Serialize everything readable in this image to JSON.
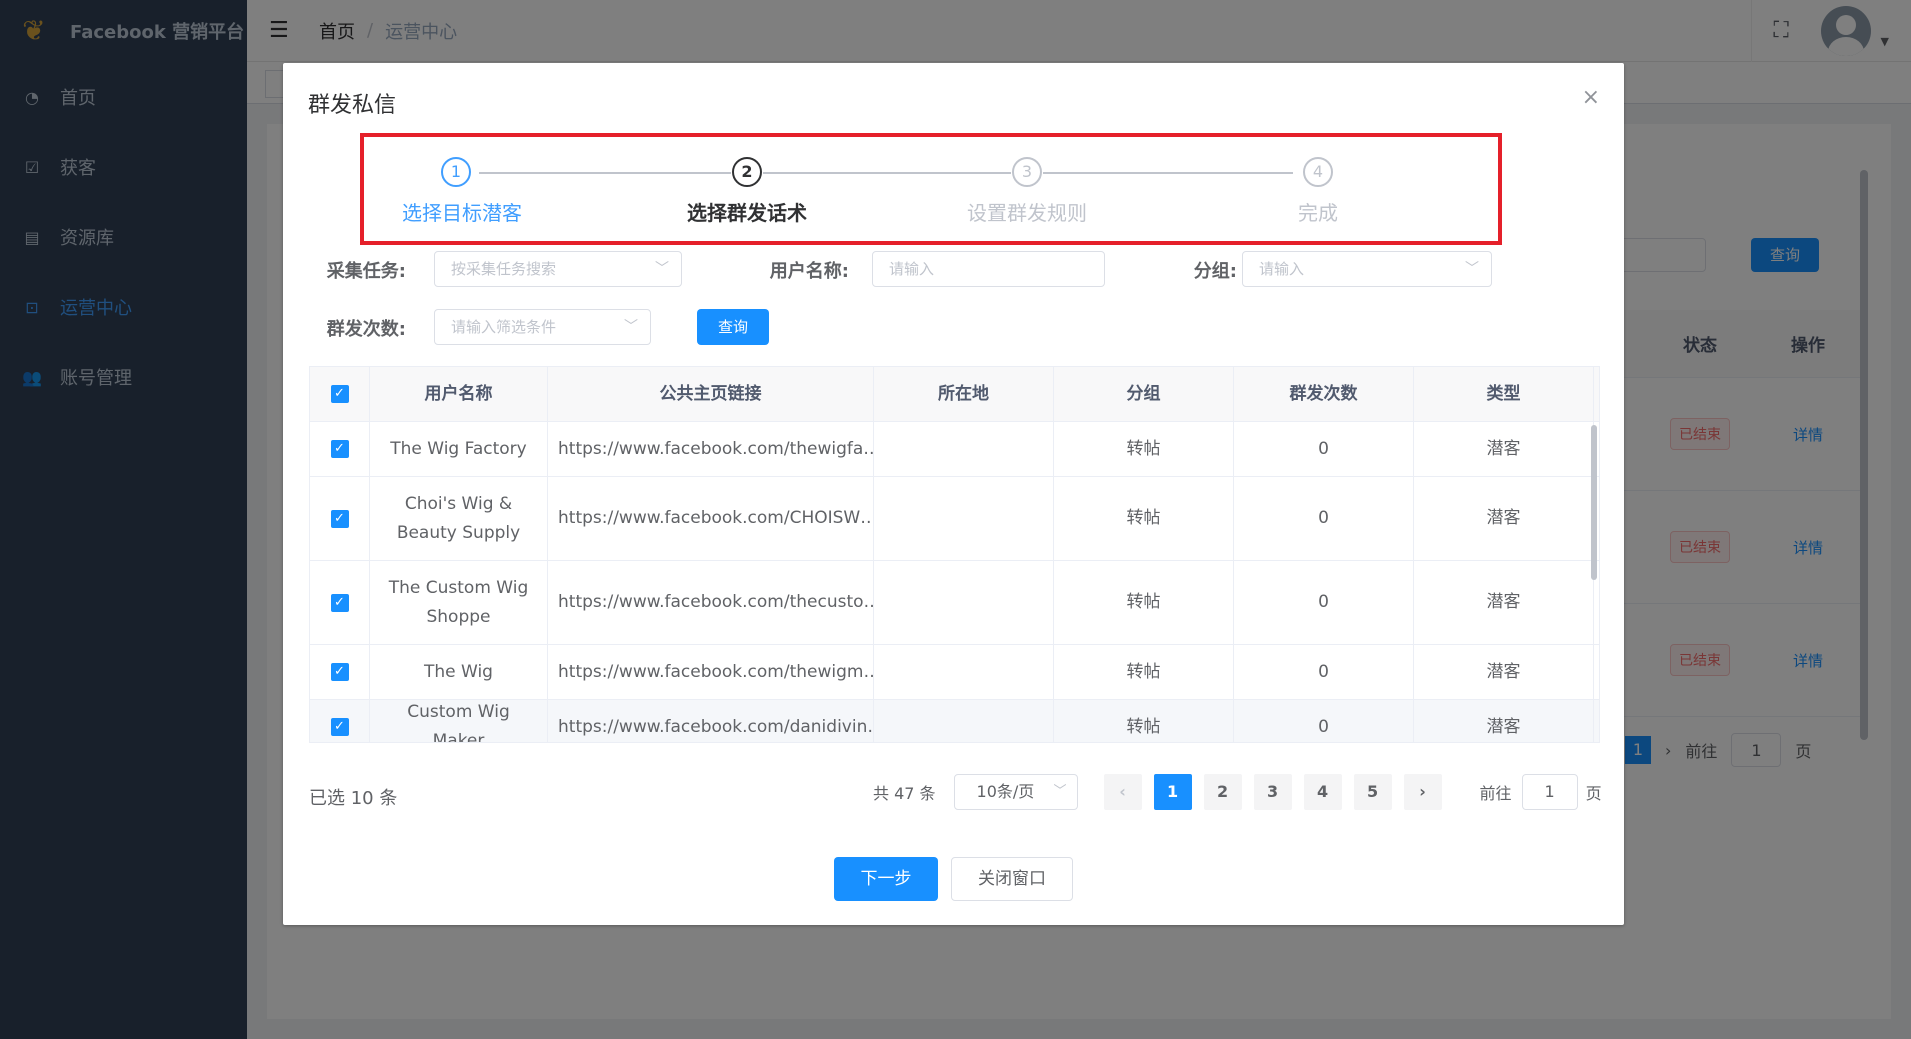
{
  "app": {
    "brand": "Facebook 营销平台"
  },
  "sidebar": {
    "items": [
      {
        "label": "首页",
        "icon": "dashboard-icon"
      },
      {
        "label": "获客",
        "icon": "checkbox-icon"
      },
      {
        "label": "资源库",
        "icon": "server-icon"
      },
      {
        "label": "运营中心",
        "icon": "chart-icon",
        "active": true
      },
      {
        "label": "账号管理",
        "icon": "users-icon"
      }
    ]
  },
  "navbar": {
    "breadcrumb": [
      "首页",
      "运营中心"
    ],
    "separator": "/"
  },
  "background": {
    "query_label": "查询",
    "table_headers": [
      "状态",
      "操作"
    ],
    "rows": [
      {
        "status": "已结束",
        "action": "详情"
      },
      {
        "status": "已结束",
        "action": "详情"
      },
      {
        "status": "已结束",
        "action": "详情"
      }
    ],
    "pager": {
      "active_page": "1",
      "goto_label": "前往",
      "goto_value": "1",
      "page_unit": "页"
    }
  },
  "dialog": {
    "title": "群发私信",
    "close_glyph": "×",
    "steps": [
      {
        "num": "1",
        "label": "选择目标潜客",
        "state": "done"
      },
      {
        "num": "2",
        "label": "选择群发话术",
        "state": "current"
      },
      {
        "num": "3",
        "label": "设置群发规则",
        "state": "wait"
      },
      {
        "num": "4",
        "label": "完成",
        "state": "wait"
      }
    ],
    "filters": {
      "task_label": "采集任务:",
      "task_placeholder": "按采集任务搜索",
      "user_label": "用户名称:",
      "user_placeholder": "请输入",
      "group_label": "分组:",
      "group_placeholder": "请输入",
      "count_label": "群发次数:",
      "count_placeholder": "请输入筛选条件",
      "query_button": "查询"
    },
    "table": {
      "headers": [
        "用户名称",
        "公共主页链接",
        "所在地",
        "分组",
        "群发次数",
        "类型"
      ],
      "rows": [
        {
          "name": "The Wig Factory",
          "url": "https://www.facebook.com/thewigfa…",
          "location": "",
          "group": "转帖",
          "count": "0",
          "type": "潜客"
        },
        {
          "name": "Choi's Wig & Beauty Supply",
          "url": "https://www.facebook.com/CHOISW…",
          "location": "",
          "group": "转帖",
          "count": "0",
          "type": "潜客"
        },
        {
          "name": "The Custom Wig Shoppe",
          "url": "https://www.facebook.com/thecusto…",
          "location": "",
          "group": "转帖",
          "count": "0",
          "type": "潜客"
        },
        {
          "name": "The Wig",
          "url": "https://www.facebook.com/thewigm…",
          "location": "",
          "group": "转帖",
          "count": "0",
          "type": "潜客"
        },
        {
          "name": "Custom Wig Maker",
          "url": "https://www.facebook.com/danidivin…",
          "location": "",
          "group": "转帖",
          "count": "0",
          "type": "潜客"
        }
      ]
    },
    "footer": {
      "selected": "已选 10 条",
      "total": "共 47 条",
      "page_size": "10条/页",
      "pages": [
        "1",
        "2",
        "3",
        "4",
        "5"
      ],
      "active_page": "1",
      "goto_label": "前往",
      "goto_value": "1",
      "page_unit": "页",
      "next_button": "下一步",
      "close_button": "关闭窗口"
    }
  },
  "colors": {
    "primary": "#1890ff",
    "sidebar": "#304156",
    "highlight_border": "#e5202a",
    "danger": "#f56c6c"
  }
}
